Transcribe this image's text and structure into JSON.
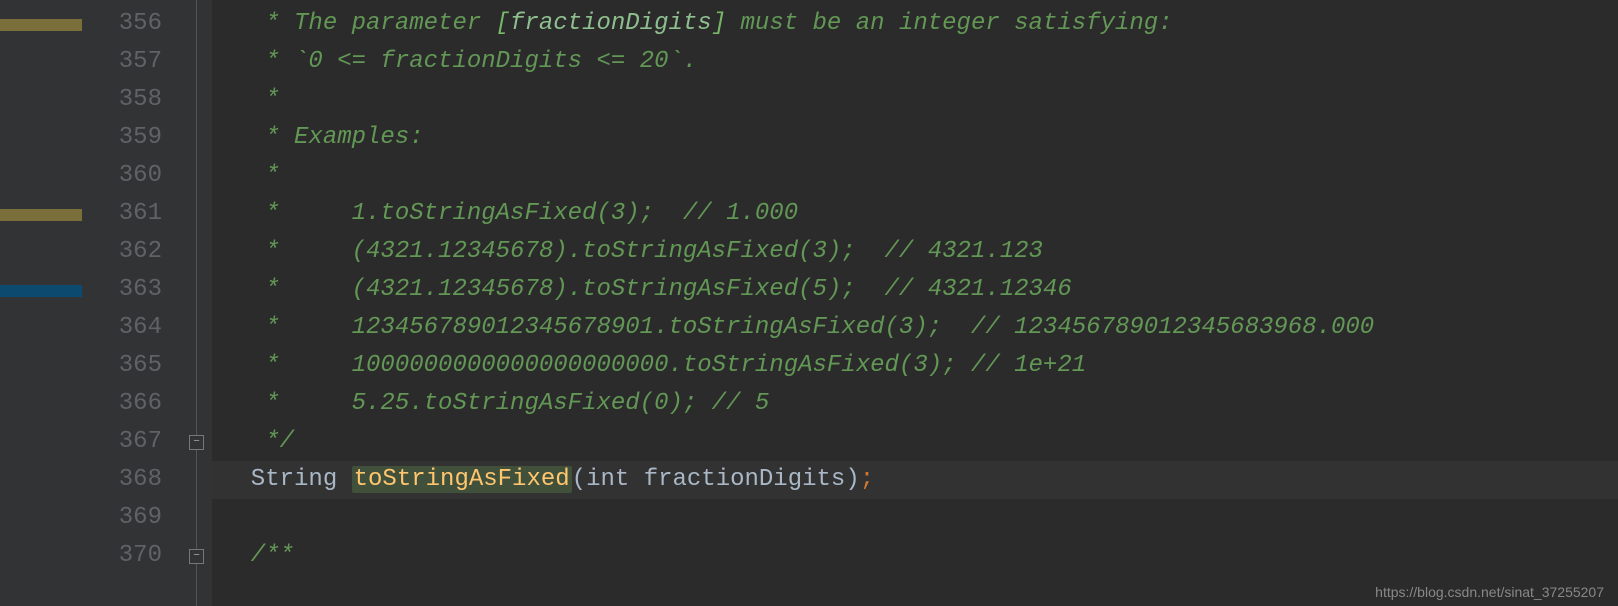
{
  "gutterStart": 356,
  "markers": [
    {
      "line": 356,
      "type": "yellow"
    },
    {
      "line": 361,
      "type": "yellow"
    },
    {
      "line": 363,
      "type": "blue"
    }
  ],
  "lines": {
    "356": {
      "type": "comment",
      "segments": [
        {
          "cls": "comment",
          "text": "   * The parameter "
        },
        {
          "cls": "comment-bracket",
          "text": "["
        },
        {
          "cls": "comment-ident",
          "text": "fractionDigits"
        },
        {
          "cls": "comment-bracket",
          "text": "]"
        },
        {
          "cls": "comment",
          "text": " must be an integer satisfying:"
        }
      ]
    },
    "357": {
      "type": "comment",
      "segments": [
        {
          "cls": "comment",
          "text": "   * `0 <= fractionDigits <= 20`."
        }
      ]
    },
    "358": {
      "type": "comment",
      "segments": [
        {
          "cls": "comment",
          "text": "   *"
        }
      ]
    },
    "359": {
      "type": "comment",
      "segments": [
        {
          "cls": "comment",
          "text": "   * Examples:"
        }
      ]
    },
    "360": {
      "type": "comment",
      "segments": [
        {
          "cls": "comment",
          "text": "   *"
        }
      ]
    },
    "361": {
      "type": "comment",
      "segments": [
        {
          "cls": "comment",
          "text": "   *     1.toStringAsFixed(3);  // 1.000"
        }
      ]
    },
    "362": {
      "type": "comment",
      "segments": [
        {
          "cls": "comment",
          "text": "   *     (4321.12345678).toStringAsFixed(3);  // 4321.123"
        }
      ]
    },
    "363": {
      "type": "comment",
      "segments": [
        {
          "cls": "comment",
          "text": "   *     (4321.12345678).toStringAsFixed(5);  // 4321.12346"
        }
      ]
    },
    "364": {
      "type": "comment",
      "segments": [
        {
          "cls": "comment",
          "text": "   *     123456789012345678901.toStringAsFixed(3);  // 123456789012345683968.000"
        }
      ]
    },
    "365": {
      "type": "comment",
      "segments": [
        {
          "cls": "comment",
          "text": "   *     1000000000000000000000.toStringAsFixed(3); // 1e+21"
        }
      ]
    },
    "366": {
      "type": "comment",
      "segments": [
        {
          "cls": "comment",
          "text": "   *     5.25.toStringAsFixed(0); // 5"
        }
      ]
    },
    "367": {
      "type": "comment",
      "segments": [
        {
          "cls": "comment",
          "text": "   */"
        }
      ]
    },
    "368": {
      "type": "code",
      "highlight": true,
      "segments": [
        {
          "cls": "type",
          "text": "  String "
        },
        {
          "cls": "method-hl",
          "text": "toStringAsFixed"
        },
        {
          "cls": "paren",
          "text": "("
        },
        {
          "cls": "type",
          "text": "int "
        },
        {
          "cls": "param",
          "text": "fractionDigits"
        },
        {
          "cls": "paren",
          "text": ")"
        },
        {
          "cls": "semi",
          "text": ";"
        }
      ]
    },
    "369": {
      "type": "blank",
      "segments": [
        {
          "cls": "type",
          "text": ""
        }
      ]
    },
    "370": {
      "type": "comment",
      "segments": [
        {
          "cls": "comment",
          "text": "  /**"
        }
      ]
    }
  },
  "foldIcons": [
    {
      "line": 367,
      "kind": "end"
    },
    {
      "line": 370,
      "kind": "start"
    }
  ],
  "watermark": "https://blog.csdn.net/sinat_37255207"
}
